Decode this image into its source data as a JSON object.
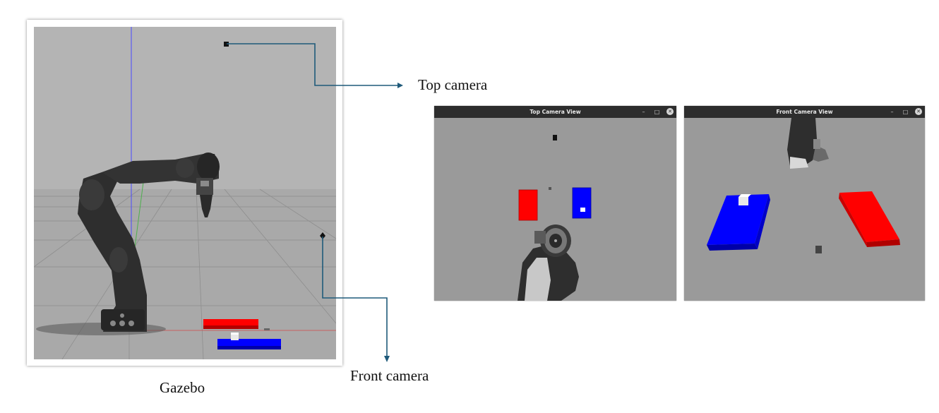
{
  "labels": {
    "gazebo": "Gazebo",
    "top_camera": "Top camera",
    "front_camera": "Front camera"
  },
  "windows": {
    "top": {
      "title": "Top Camera View",
      "controls": {
        "minimize": "–",
        "maximize": "□",
        "close": "✕"
      }
    },
    "front": {
      "title": "Front Camera View",
      "controls": {
        "minimize": "–",
        "maximize": "□",
        "close": "✕"
      }
    }
  },
  "colors": {
    "callout_line": "#1f5a7a",
    "red_block": "#ff0000",
    "blue_block": "#0000ff",
    "floor": "#9a9a9a",
    "titlebar": "#2d2d2d"
  }
}
